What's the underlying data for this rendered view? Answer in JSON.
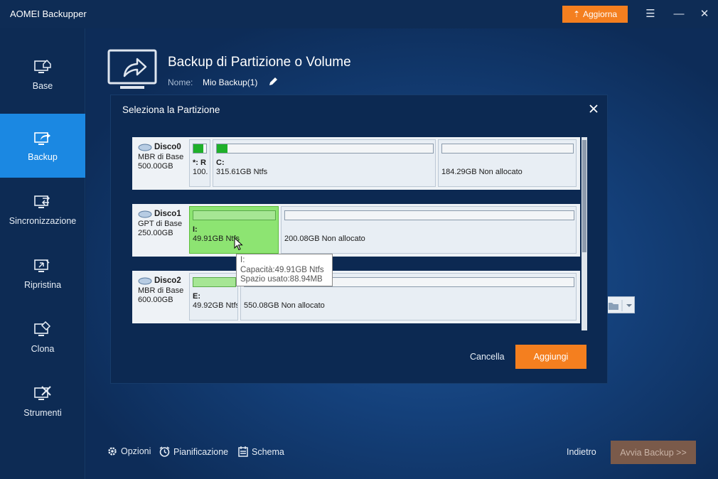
{
  "app": {
    "title": "AOMEI Backupper",
    "upgrade_label": "Aggiorna"
  },
  "sidebar": {
    "items": [
      {
        "label": "Base",
        "icon": "home-monitor-icon"
      },
      {
        "label": "Backup",
        "icon": "backup-export-icon",
        "active": true
      },
      {
        "label": "Sincronizzazione",
        "icon": "sync-icon"
      },
      {
        "label": "Ripristina",
        "icon": "restore-icon"
      },
      {
        "label": "Clona",
        "icon": "clone-icon"
      },
      {
        "label": "Strumenti",
        "icon": "tools-icon"
      }
    ]
  },
  "header": {
    "title": "Backup di Partizione o Volume",
    "name_label": "Nome:",
    "name_value": "Mio Backup(1)"
  },
  "dialog": {
    "title": "Seleziona la Partizione",
    "cancel_label": "Cancella",
    "add_label": "Aggiungi",
    "disks": [
      {
        "name": "Disco0",
        "type": "MBR di Base",
        "size": "500.00GB",
        "partitions": [
          {
            "label": "*: R",
            "size": "100.",
            "used_fraction": 0.8
          },
          {
            "label": "C:",
            "size": "315.61GB Ntfs",
            "used_fraction": 0.05
          },
          {
            "label": "",
            "size": "184.29GB Non allocato",
            "used_fraction": 0
          }
        ]
      },
      {
        "name": "Disco1",
        "type": "GPT di Base",
        "size": "250.00GB",
        "partitions": [
          {
            "label": "I:",
            "size": "49.91GB Ntfs",
            "used_fraction": 0,
            "selected": true
          },
          {
            "label": "",
            "size": "200.08GB Non allocato",
            "used_fraction": 0
          }
        ]
      },
      {
        "name": "Disco2",
        "type": "MBR di Base",
        "size": "600.00GB",
        "partitions": [
          {
            "label": "E:",
            "size": "49.92GB Ntfs",
            "used_fraction": 0
          },
          {
            "label": "",
            "size": "550.08GB Non allocato",
            "used_fraction": 0
          }
        ]
      }
    ],
    "tooltip": {
      "line1": "I:",
      "line2": "Capacità:49.91GB Ntfs",
      "line3": "Spazio usato:88.94MB"
    }
  },
  "bottom": {
    "options_label": "Opzioni",
    "schedule_label": "Pianificazione",
    "scheme_label": "Schema",
    "back_label": "Indietro",
    "start_label": "Avvia Backup >>"
  },
  "colors": {
    "accent": "#f47f1f",
    "active_nav": "#1b88e2",
    "selected_partition": "#8de472"
  }
}
